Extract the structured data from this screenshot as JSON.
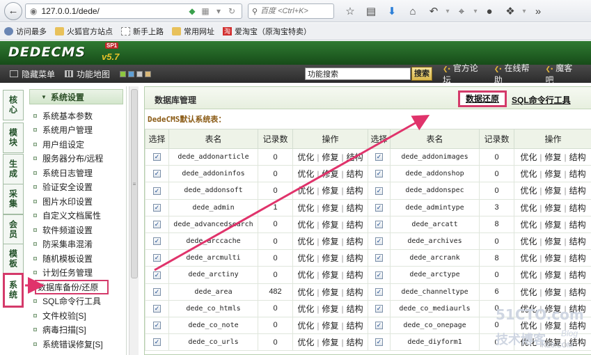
{
  "browser": {
    "url": "127.0.0.1/dede/",
    "search_placeholder": "百度 <Ctrl+K>",
    "bookmarks": [
      "访问最多",
      "火狐官方站点",
      "新手上路",
      "常用网址",
      "爱淘宝（原淘宝特卖）"
    ],
    "bookmark_red_icon": "淘"
  },
  "header": {
    "logo": "DEDECMS",
    "version": "v5.7",
    "badge": "SP1"
  },
  "menubar": {
    "hide_menu": "隐藏菜单",
    "func_map": "功能地图",
    "search_value": "功能搜索",
    "search_button": "搜索",
    "links": [
      "官方论坛",
      "在线帮助",
      "魔客吧"
    ],
    "swatch_colors": [
      "#8ec640",
      "#5fa0d6",
      "#c7c7c7",
      "#d9b878"
    ]
  },
  "left_tabs": [
    "核心",
    "模块",
    "生成",
    "采集",
    "会员",
    "模板",
    "系统"
  ],
  "sidebar": {
    "heading": "系统设置",
    "items": [
      "系统基本参数",
      "系统用户管理",
      "用户组设定",
      "服务器分布/远程",
      "系统日志管理",
      "验证安全设置",
      "图片水印设置",
      "自定义文档属性",
      "软件频道设置",
      "防采集串混淆",
      "随机模板设置",
      "计划任务管理",
      "数据库备份/还原",
      "SQL命令行工具",
      "文件校验[S]",
      "病毒扫描[S]",
      "系统错误修复[S]"
    ]
  },
  "main": {
    "title": "数据库管理",
    "restore_link": "数据还原",
    "sql_link": "SQL命令行工具",
    "subtitle": "DedeCMS默认系统表：",
    "columns": [
      "选择",
      "表名",
      "记录数",
      "操作",
      "选择",
      "表名",
      "记录数",
      "操作"
    ],
    "ops": [
      "优化",
      "修复",
      "结构"
    ],
    "check_mark": "✓",
    "rows": [
      {
        "left": "dede_addonarticle",
        "left_count": "0",
        "right": "dede_addonimages",
        "right_count": "0"
      },
      {
        "left": "dede_addoninfos",
        "left_count": "0",
        "right": "dede_addonshop",
        "right_count": "0"
      },
      {
        "left": "dede_addonsoft",
        "left_count": "0",
        "right": "dede_addonspec",
        "right_count": "0"
      },
      {
        "left": "dede_admin",
        "left_count": "1",
        "right": "dede_admintype",
        "right_count": "3"
      },
      {
        "left": "dede_advancedsearch",
        "left_count": "0",
        "right": "dede_arcatt",
        "right_count": "8"
      },
      {
        "left": "dede_arccache",
        "left_count": "0",
        "right": "dede_archives",
        "right_count": "0"
      },
      {
        "left": "dede_arcmulti",
        "left_count": "0",
        "right": "dede_arcrank",
        "right_count": "8"
      },
      {
        "left": "dede_arctiny",
        "left_count": "0",
        "right": "dede_arctype",
        "right_count": "0"
      },
      {
        "left": "dede_area",
        "left_count": "482",
        "right": "dede_channeltype",
        "right_count": "6"
      },
      {
        "left": "dede_co_htmls",
        "left_count": "0",
        "right": "dede_co_mediaurls",
        "right_count": "0"
      },
      {
        "left": "dede_co_note",
        "left_count": "0",
        "right": "dede_co_onepage",
        "right_count": "0"
      },
      {
        "left": "dede_co_urls",
        "left_count": "0",
        "right": "dede_diyform1",
        "right_count": "0"
      }
    ]
  },
  "watermark": {
    "line1": "51CTO.com",
    "line2": "技术博客",
    "line3": "Blog",
    "line4": "KE8.COM"
  },
  "annotation_color": "#e0336b"
}
